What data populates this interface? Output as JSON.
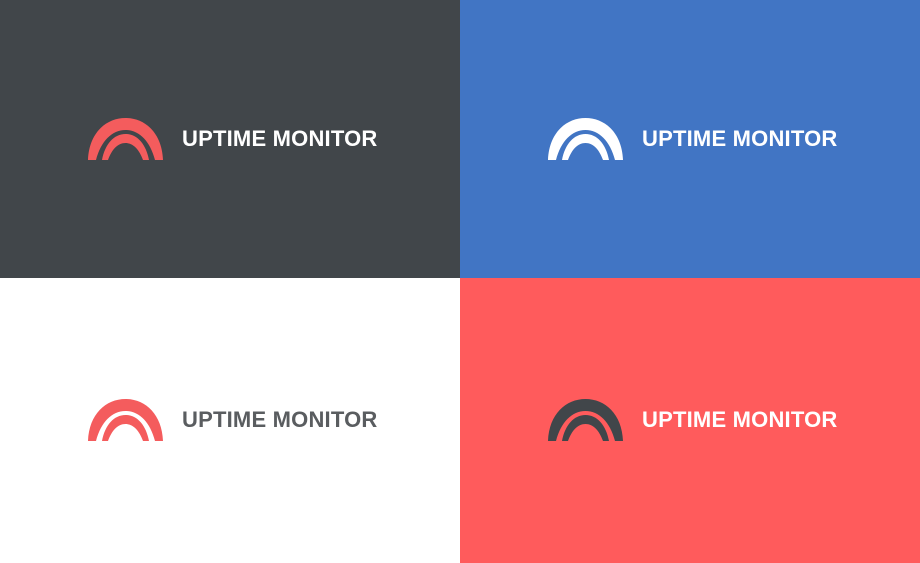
{
  "brand": {
    "name": "UPTIME MONITOR",
    "mark_icon": "rainbow-arch-icon"
  },
  "variants": [
    {
      "id": "dark",
      "background": "#41464a",
      "mark_color": "#f45c5d",
      "text_color": "#ffffff"
    },
    {
      "id": "blue",
      "background": "#4175c4",
      "mark_color": "#ffffff",
      "text_color": "#ffffff"
    },
    {
      "id": "white",
      "background": "#ffffff",
      "mark_color": "#f45c5d",
      "text_color": "#5a5d60"
    },
    {
      "id": "coral",
      "background": "#ff5b5c",
      "mark_color": "#41464a",
      "text_color": "#ffffff"
    }
  ]
}
